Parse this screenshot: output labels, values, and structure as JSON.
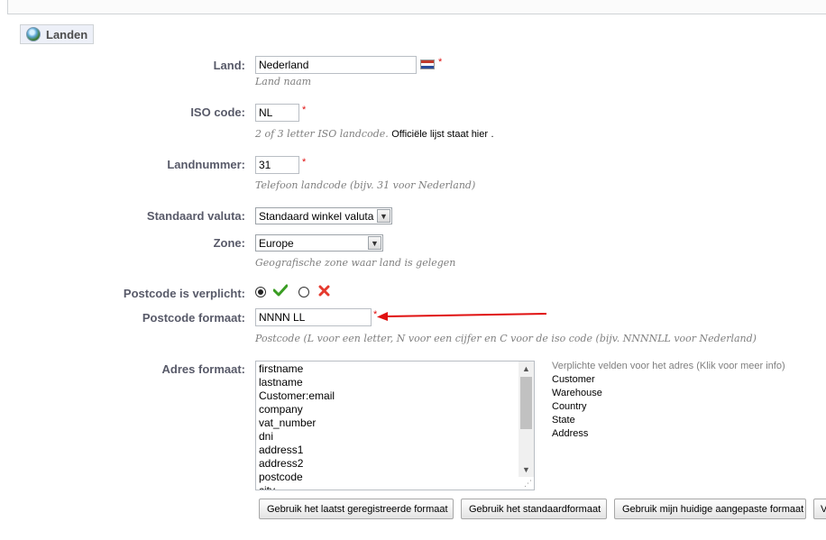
{
  "fieldset": {
    "legend": "Landen"
  },
  "land": {
    "label": "Land:",
    "value": "Nederland",
    "hint": "Land naam",
    "required": "*"
  },
  "iso": {
    "label": "ISO code:",
    "value": "NL",
    "required": "*",
    "hint": "2 of 3 letter ISO landcode.",
    "hint_link": "Officiële lijst staat hier",
    "hint_end": "."
  },
  "landnummer": {
    "label": "Landnummer:",
    "value": "31",
    "required": "*",
    "hint": "Telefoon landcode (bijv. 31 voor Nederland)"
  },
  "valuta": {
    "label": "Standaard valuta:",
    "value": "Standaard winkel valuta"
  },
  "zone": {
    "label": "Zone:",
    "value": "Europe",
    "hint": "Geografische zone waar land is gelegen"
  },
  "postcode_verplicht": {
    "label": "Postcode is verplicht:",
    "yes_icon": "check-icon",
    "no_icon": "cross-icon",
    "selected": "yes"
  },
  "postcode_formaat": {
    "label": "Postcode formaat:",
    "value": "NNNN LL",
    "required": "*",
    "hint": "Postcode (L voor een letter, N voor een cijfer en C voor de iso code (bijv. NNNNLL voor Nederland)"
  },
  "adres_formaat": {
    "label": "Adres formaat:",
    "lines": [
      "firstname",
      "lastname",
      "Customer:email",
      "company",
      "vat_number",
      "dni",
      "address1",
      "address2",
      "postcode",
      "city"
    ]
  },
  "side_panel": {
    "title": "Verplichte velden voor het adres (Klik voor meer info)",
    "items": [
      "Customer",
      "Warehouse",
      "Country",
      "State",
      "Address"
    ]
  },
  "buttons": {
    "last_format": "Gebruik het laatst geregistreerde formaat",
    "default_format": "Gebruik het standaardformaat",
    "custom_format": "Gebruik mijn huidige aangepaste formaat",
    "partial": "V"
  },
  "colors": {
    "required": "#e01010",
    "label": "#585a69",
    "background": "#edf0f8",
    "arrow": "#e01010"
  }
}
